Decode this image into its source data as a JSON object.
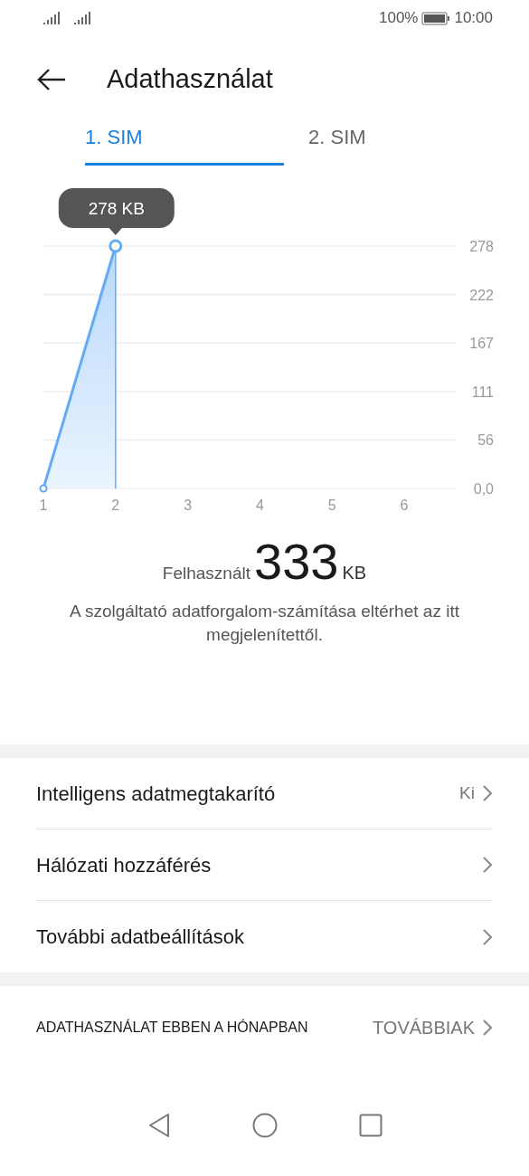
{
  "status_bar": {
    "battery_text": "100%",
    "time": "10:00"
  },
  "header": {
    "title": "Adathasználat"
  },
  "tabs": [
    {
      "label": "1. SIM",
      "selected": true
    },
    {
      "label": "2. SIM",
      "selected": false
    }
  ],
  "chart": {
    "chart_data": {
      "type": "area",
      "x": [
        1,
        2
      ],
      "series": [
        {
          "color": "#64aaf5",
          "values": [
            0,
            278
          ]
        }
      ],
      "grid": true,
      "ref_lines": [
        {
          "axis": "x",
          "value": 2
        }
      ],
      "xlim": [
        1,
        6.73
      ],
      "ylim": [
        0,
        278
      ],
      "xticks": [
        1,
        2,
        3,
        4,
        5,
        6
      ],
      "yticks": [
        {
          "value": 0,
          "label": "0,0"
        },
        {
          "value": 55.6,
          "label": "56"
        },
        {
          "value": 111.2,
          "label": "111"
        },
        {
          "value": 166.8,
          "label": "167"
        },
        {
          "value": 222.4,
          "label": "222"
        },
        {
          "value": 278,
          "label": "278"
        }
      ],
      "annotations": [
        {
          "x": 2,
          "y": 278,
          "text": "278 KB"
        }
      ]
    }
  },
  "usage": {
    "label": "Felhasznált",
    "amount": "333",
    "unit": "KB"
  },
  "note": "A szolgáltató adatforgalom-számítása eltérhet az itt megjelenítettől.",
  "settings": [
    {
      "label": "Intelligens adatmegtakarító",
      "value": "Ki"
    },
    {
      "label": "Hálózati hozzáférés"
    },
    {
      "label": "További adatbeállítások"
    }
  ],
  "footer": {
    "title": "ADATHASZNÁLAT EBBEN A HÓNAPBAN",
    "link": "TOVÁBBIAK"
  }
}
